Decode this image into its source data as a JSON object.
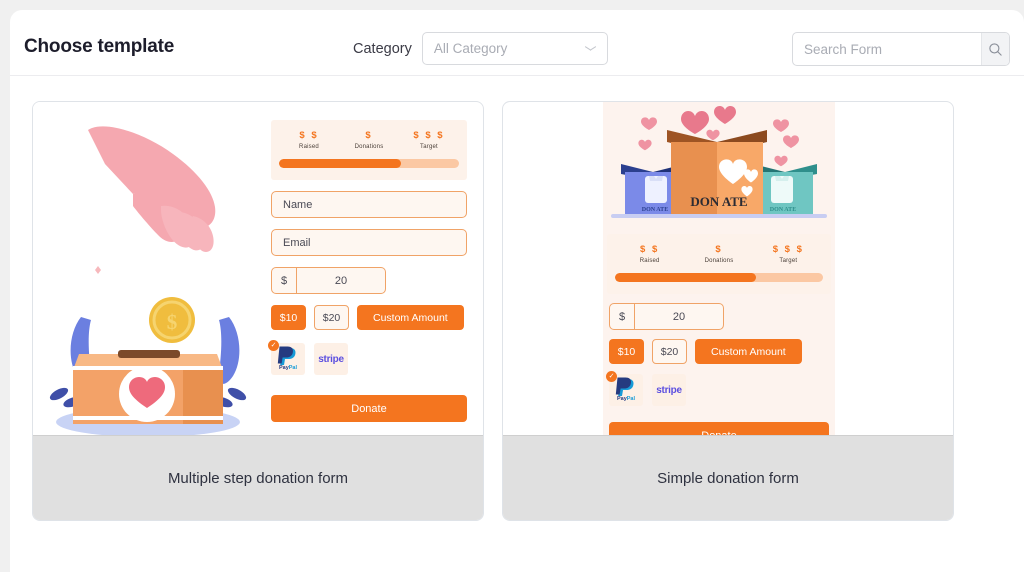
{
  "header": {
    "title": "Choose template",
    "category_label": "Category",
    "category_value": "All Category",
    "category_icon": "chevron-down-icon",
    "search_placeholder": "Search Form",
    "search_value": "",
    "search_icon": "search-icon"
  },
  "colors": {
    "accent": "#f4751f",
    "accent_light": "#fbc8a3",
    "field_bg": "#fef7f1",
    "field_border": "#f0a367",
    "stats_bg": "#fdf2ea",
    "card_border": "#dfe3e8",
    "footer_bg": "#e0e0e0",
    "page_bg": "#f0f0f0",
    "paypal_blue": "#253b80",
    "paypal_cyan": "#179bd7",
    "stripe_purple": "#5c4fe0"
  },
  "form_widgets": {
    "stats": [
      {
        "amount": "$ $",
        "label": "Raised"
      },
      {
        "amount": "$",
        "label": "Donations"
      },
      {
        "amount": "$ $ $",
        "label": "Target"
      }
    ],
    "progress_percent": 68,
    "name_placeholder": "Name",
    "email_placeholder": "Email",
    "currency_symbol": "$",
    "amount_value": "20",
    "amount_buttons": [
      {
        "label": "$10",
        "style": "solid"
      },
      {
        "label": "$20",
        "style": "outline"
      },
      {
        "label": "Custom Amount",
        "style": "custom"
      }
    ],
    "payments": [
      {
        "name": "paypal",
        "label_a": "Pay",
        "label_b": "Pal",
        "selected": true,
        "check": "✓"
      },
      {
        "name": "stripe",
        "label": "stripe",
        "selected": false
      }
    ],
    "donate_label": "Donate"
  },
  "cards": [
    {
      "id": "multiple-step",
      "footer_label": "Multiple step donation form",
      "illustration": "hand-dropping-coin-into-donation-box"
    },
    {
      "id": "simple",
      "footer_label": "Simple donation form",
      "illustration": "donation-boxes-with-hearts",
      "box_label": "DON ATE"
    }
  ]
}
